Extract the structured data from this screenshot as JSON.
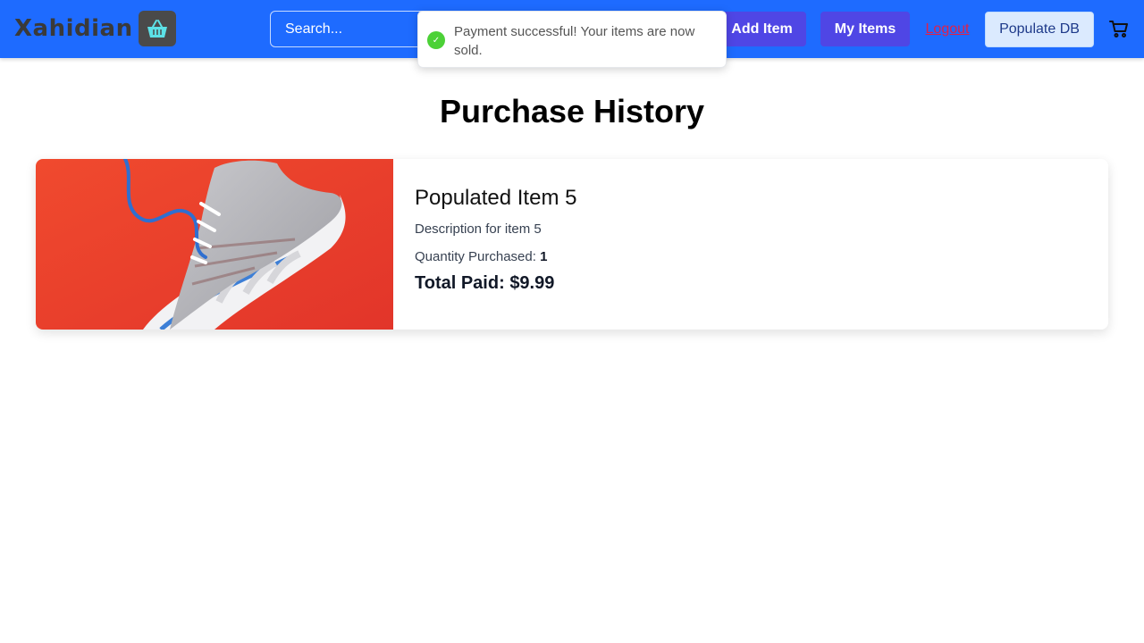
{
  "navbar": {
    "brand": "Xahidian",
    "brand_icon": "shopping-basket-icon",
    "search_placeholder": "Search...",
    "add_item_label": "Add Item",
    "my_items_label": "My Items",
    "logout_label": "Logout",
    "populate_label": "Populate DB",
    "cart_icon": "cart-icon",
    "colors": {
      "bar": "#1e6bff",
      "primary_button": "#4f46e5",
      "logout": "#e0204a"
    }
  },
  "toast": {
    "message": "Payment successful! Your items are now sold.",
    "status_color": "#4cd137"
  },
  "page": {
    "title": "Purchase History"
  },
  "purchases": [
    {
      "title": "Populated Item 5",
      "description": "Description for item 5",
      "quantity_label": "Quantity Purchased:",
      "quantity": "1",
      "total_label": "Total Paid:",
      "total": "$9.99"
    }
  ]
}
